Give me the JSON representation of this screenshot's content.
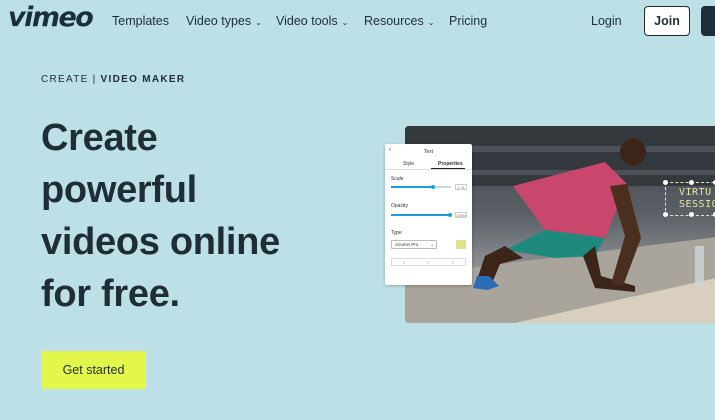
{
  "brand": {
    "logo_text": "vimeo"
  },
  "nav": {
    "items": [
      {
        "label": "Templates",
        "has_dropdown": false
      },
      {
        "label": "Video types",
        "has_dropdown": true
      },
      {
        "label": "Video tools",
        "has_dropdown": true
      },
      {
        "label": "Resources",
        "has_dropdown": true
      },
      {
        "label": "Pricing",
        "has_dropdown": false
      }
    ],
    "login_label": "Login",
    "join_label": "Join"
  },
  "hero": {
    "eyebrow_left": "CREATE",
    "eyebrow_separator": "|",
    "eyebrow_right": "VIDEO MAKER",
    "headline_lines": [
      "Create",
      "powerful",
      "videos online",
      "for free."
    ],
    "cta_label": "Get started"
  },
  "preview": {
    "overlay_text_lines": [
      "VIRTU",
      "SESSIO"
    ],
    "panel": {
      "title": "Text",
      "tabs": [
        "Style",
        "Properties"
      ],
      "active_tab": "Properties",
      "scale_label": "Scale",
      "scale_value": "1 %",
      "opacity_label": "Opacity",
      "opacity_value": "100%",
      "type_label": "Type",
      "font_select": "Acumin Pro"
    }
  },
  "colors": {
    "background": "#bde0e7",
    "cta": "#e3f74a",
    "text": "#1f2d36",
    "slider_accent": "#1a9edc"
  }
}
